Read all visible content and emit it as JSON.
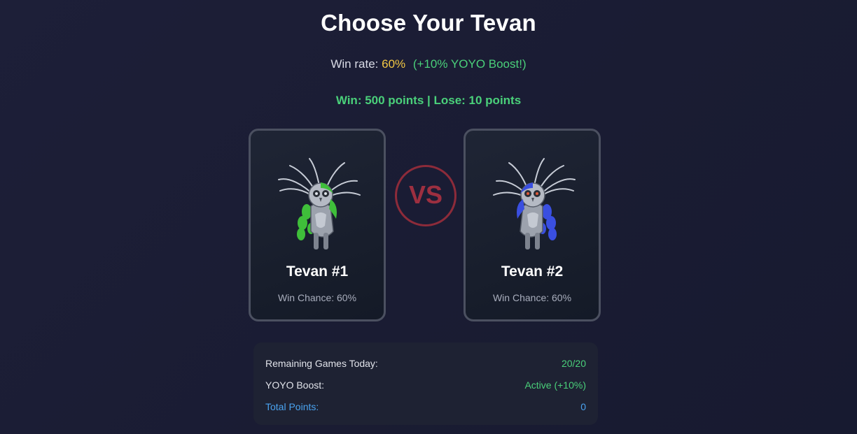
{
  "header": {
    "title": "Choose Your Tevan",
    "win_rate_label": "Win rate:",
    "win_rate_value": "60%",
    "boost_note": "(+10% YOYO Boost!)",
    "stakes": "Win: 500 points | Lose: 10 points"
  },
  "cards": [
    {
      "name": "Tevan #1",
      "chance": "Win Chance: 60%",
      "accent_color": "#3fbf3a",
      "icon": "green-tevan-owl-icon"
    },
    {
      "name": "Tevan #2",
      "chance": "Win Chance: 60%",
      "accent_color": "#3a4fe0",
      "icon": "blue-tevan-owl-icon"
    }
  ],
  "vs_label": "VS",
  "stats": {
    "remaining_label": "Remaining Games Today:",
    "remaining_value": "20/20",
    "boost_label": "YOYO Boost:",
    "boost_value": "Active (+10%)",
    "points_label": "Total Points:",
    "points_value": "0"
  },
  "colors": {
    "background": "#1c1e36",
    "highlight_yellow": "#f2c744",
    "success_green": "#4ad07a",
    "info_blue": "#4aa3f0",
    "vs_red": "#9d2f40",
    "card_border": "#4b5060"
  }
}
